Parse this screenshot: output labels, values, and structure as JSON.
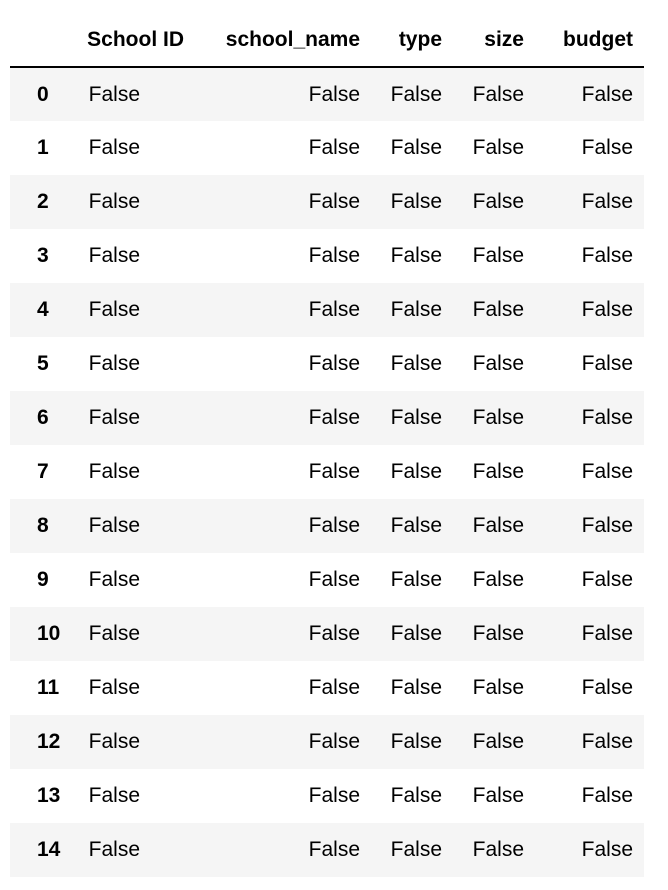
{
  "table": {
    "columns": [
      "School ID",
      "school_name",
      "type",
      "size",
      "budget"
    ],
    "rows": [
      {
        "index": "0",
        "values": [
          "False",
          "False",
          "False",
          "False",
          "False"
        ]
      },
      {
        "index": "1",
        "values": [
          "False",
          "False",
          "False",
          "False",
          "False"
        ]
      },
      {
        "index": "2",
        "values": [
          "False",
          "False",
          "False",
          "False",
          "False"
        ]
      },
      {
        "index": "3",
        "values": [
          "False",
          "False",
          "False",
          "False",
          "False"
        ]
      },
      {
        "index": "4",
        "values": [
          "False",
          "False",
          "False",
          "False",
          "False"
        ]
      },
      {
        "index": "5",
        "values": [
          "False",
          "False",
          "False",
          "False",
          "False"
        ]
      },
      {
        "index": "6",
        "values": [
          "False",
          "False",
          "False",
          "False",
          "False"
        ]
      },
      {
        "index": "7",
        "values": [
          "False",
          "False",
          "False",
          "False",
          "False"
        ]
      },
      {
        "index": "8",
        "values": [
          "False",
          "False",
          "False",
          "False",
          "False"
        ]
      },
      {
        "index": "9",
        "values": [
          "False",
          "False",
          "False",
          "False",
          "False"
        ]
      },
      {
        "index": "10",
        "values": [
          "False",
          "False",
          "False",
          "False",
          "False"
        ]
      },
      {
        "index": "11",
        "values": [
          "False",
          "False",
          "False",
          "False",
          "False"
        ]
      },
      {
        "index": "12",
        "values": [
          "False",
          "False",
          "False",
          "False",
          "False"
        ]
      },
      {
        "index": "13",
        "values": [
          "False",
          "False",
          "False",
          "False",
          "False"
        ]
      },
      {
        "index": "14",
        "values": [
          "False",
          "False",
          "False",
          "False",
          "False"
        ]
      }
    ]
  },
  "colors": {
    "stripe": "#f5f5f5",
    "background": "#ffffff",
    "header_rule": "#000000"
  }
}
